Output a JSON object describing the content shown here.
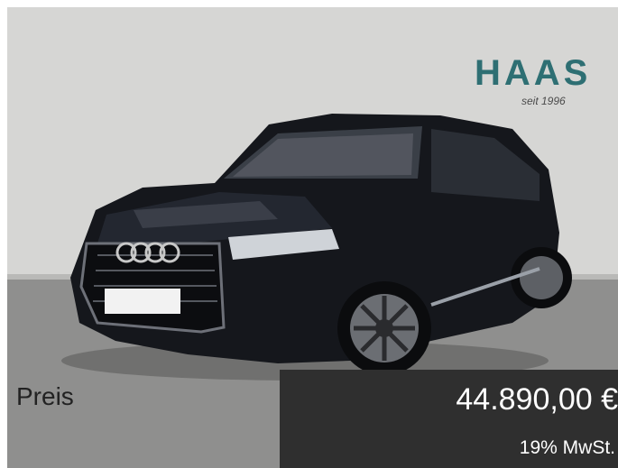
{
  "listing": {
    "price_label": "Preis",
    "price": "44.890,00 €",
    "tax_note": "19% MwSt."
  },
  "photo": {
    "subject": "car-photo",
    "logo_text": "HAAS",
    "logo_tagline": "seit 1996"
  },
  "colors": {
    "price_box_background": "#2f2f2f",
    "price_text": "#ffffff",
    "label_text": "#222222",
    "logo_teal": "#2e6f73"
  }
}
